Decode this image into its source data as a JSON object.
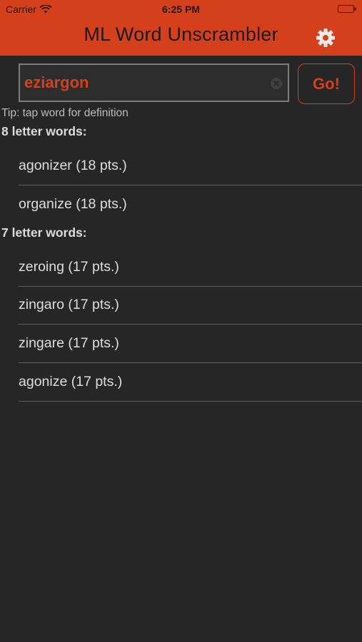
{
  "status_bar": {
    "carrier": "Carrier",
    "time": "6:25 PM"
  },
  "header": {
    "title": "ML Word Unscrambler",
    "settings_icon": "gear-icon",
    "background_color": "#d5401c"
  },
  "search": {
    "value": "eziargon",
    "clear_icon": "clear-circle-icon"
  },
  "go_button": {
    "label": "Go!"
  },
  "tip": "Tip: tap word for definition",
  "sections": [
    {
      "heading": "8 letter words:",
      "words": [
        {
          "label": "agonizer (18 pts.)"
        },
        {
          "label": "organize (18 pts.)"
        }
      ]
    },
    {
      "heading": "7 letter words:",
      "words": [
        {
          "label": "zeroing (17 pts.)"
        },
        {
          "label": "zingaro (17 pts.)"
        },
        {
          "label": "zingare (17 pts.)"
        },
        {
          "label": "agonize (17 pts.)"
        }
      ]
    }
  ],
  "colors": {
    "accent": "#d5401c",
    "background": "#262626",
    "text": "#dedede"
  }
}
